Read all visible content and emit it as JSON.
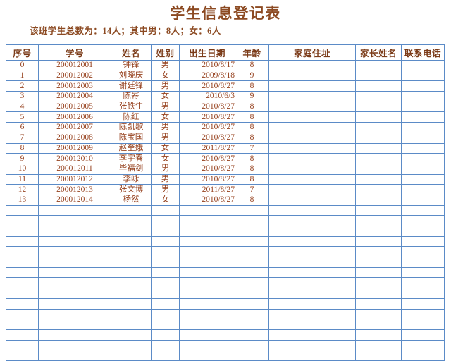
{
  "document": {
    "title": "学生信息登记表",
    "subtitle": "该班学生总数为：14人；其中男：8人；女：6人"
  },
  "table": {
    "columns": [
      {
        "key": "seq",
        "label": "序号"
      },
      {
        "key": "sid",
        "label": "学号"
      },
      {
        "key": "name",
        "label": "姓名"
      },
      {
        "key": "sex",
        "label": "姓别"
      },
      {
        "key": "birth",
        "label": "出生日期"
      },
      {
        "key": "age",
        "label": "年龄"
      },
      {
        "key": "addr",
        "label": "家庭住址"
      },
      {
        "key": "guard",
        "label": "家长姓名"
      },
      {
        "key": "phone",
        "label": "联系电话"
      }
    ],
    "rows": [
      {
        "seq": "0",
        "sid": "200012001",
        "name": "钟锋",
        "sex": "男",
        "birth": "2010/8/17",
        "age": "8",
        "addr": "",
        "guard": "",
        "phone": ""
      },
      {
        "seq": "1",
        "sid": "200012002",
        "name": "刘晓庆",
        "sex": "女",
        "birth": "2009/8/18",
        "age": "9",
        "addr": "",
        "guard": "",
        "phone": ""
      },
      {
        "seq": "2",
        "sid": "200012003",
        "name": "谢廷锋",
        "sex": "男",
        "birth": "2010/8/27",
        "age": "8",
        "addr": "",
        "guard": "",
        "phone": ""
      },
      {
        "seq": "3",
        "sid": "200012004",
        "name": "陈幂",
        "sex": "女",
        "birth": "2010/6/3",
        "age": "9",
        "addr": "",
        "guard": "",
        "phone": ""
      },
      {
        "seq": "4",
        "sid": "200012005",
        "name": "张铁生",
        "sex": "男",
        "birth": "2010/8/27",
        "age": "8",
        "addr": "",
        "guard": "",
        "phone": ""
      },
      {
        "seq": "5",
        "sid": "200012006",
        "name": "陈红",
        "sex": "女",
        "birth": "2010/8/27",
        "age": "8",
        "addr": "",
        "guard": "",
        "phone": ""
      },
      {
        "seq": "6",
        "sid": "200012007",
        "name": "陈凯歌",
        "sex": "男",
        "birth": "2010/8/27",
        "age": "8",
        "addr": "",
        "guard": "",
        "phone": ""
      },
      {
        "seq": "7",
        "sid": "200012008",
        "name": "陈宝国",
        "sex": "男",
        "birth": "2010/8/27",
        "age": "8",
        "addr": "",
        "guard": "",
        "phone": ""
      },
      {
        "seq": "8",
        "sid": "200012009",
        "name": "赵奎娥",
        "sex": "女",
        "birth": "2011/8/27",
        "age": "7",
        "addr": "",
        "guard": "",
        "phone": ""
      },
      {
        "seq": "9",
        "sid": "200012010",
        "name": "李宇春",
        "sex": "女",
        "birth": "2010/8/27",
        "age": "8",
        "addr": "",
        "guard": "",
        "phone": ""
      },
      {
        "seq": "10",
        "sid": "200012011",
        "name": "毕福剑",
        "sex": "男",
        "birth": "2010/8/27",
        "age": "8",
        "addr": "",
        "guard": "",
        "phone": ""
      },
      {
        "seq": "11",
        "sid": "200012012",
        "name": "李咏",
        "sex": "男",
        "birth": "2010/8/27",
        "age": "8",
        "addr": "",
        "guard": "",
        "phone": ""
      },
      {
        "seq": "12",
        "sid": "200012013",
        "name": "张文博",
        "sex": "男",
        "birth": "2011/8/27",
        "age": "7",
        "addr": "",
        "guard": "",
        "phone": ""
      },
      {
        "seq": "13",
        "sid": "200012014",
        "name": "杨然",
        "sex": "女",
        "birth": "2010/8/27",
        "age": "8",
        "addr": "",
        "guard": "",
        "phone": ""
      }
    ],
    "empty_row_count": 15
  },
  "colors": {
    "header_fill": "#B4C8E2",
    "grid_line": "#5B8BC7",
    "text_brown": "#96411E",
    "title_brown": "#8C4A22",
    "background": "#FFFFFF"
  }
}
